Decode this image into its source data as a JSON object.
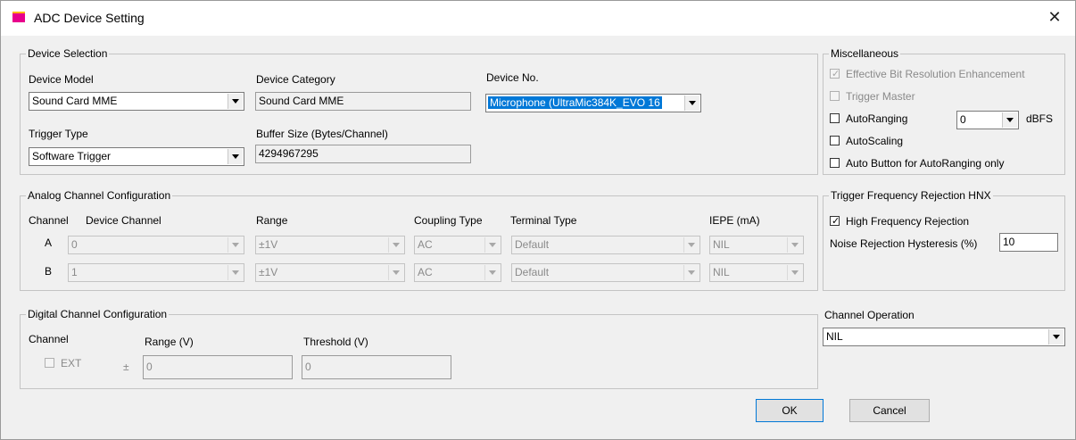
{
  "window": {
    "title": "ADC Device Setting",
    "close_glyph": "✕"
  },
  "device_selection": {
    "legend": "Device Selection",
    "model_label": "Device Model",
    "model_value": "Sound Card MME",
    "category_label": "Device Category",
    "category_value": "Sound Card MME",
    "device_no_label": "Device No.",
    "device_no_value": "Microphone (UltraMic384K_EVO 16",
    "trigger_label": "Trigger Type",
    "trigger_value": "Software Trigger",
    "buffer_label": "Buffer Size (Bytes/Channel)",
    "buffer_value": "4294967295"
  },
  "misc": {
    "legend": "Miscellaneous",
    "ebre": "Effective Bit Resolution Enhancement",
    "trigger_master": "Trigger Master",
    "autoranging": "AutoRanging",
    "autoranging_value": "0",
    "dbfs": "dBFS",
    "autoscaling": "AutoScaling",
    "auto_button": "Auto Button for AutoRanging only"
  },
  "analog": {
    "legend": "Analog Channel Configuration",
    "headers": {
      "channel": "Channel",
      "device_channel": "Device Channel",
      "range": "Range",
      "coupling": "Coupling Type",
      "terminal": "Terminal Type",
      "iepe": "IEPE (mA)"
    },
    "rows": [
      {
        "name": "A",
        "device_channel": "0",
        "range": "±1V",
        "coupling": "AC",
        "terminal": "Default",
        "iepe": "NIL"
      },
      {
        "name": "B",
        "device_channel": "1",
        "range": "±1V",
        "coupling": "AC",
        "terminal": "Default",
        "iepe": "NIL"
      }
    ]
  },
  "trigger_freq": {
    "legend": "Trigger Frequency Rejection HNX",
    "hfr": "High Frequency Rejection",
    "hysteresis_label": "Noise Rejection Hysteresis (%)",
    "hysteresis_value": "10"
  },
  "digital": {
    "legend": "Digital Channel Configuration",
    "channel": "Channel",
    "range_label": "Range (V)",
    "threshold_label": "Threshold (V)",
    "ext": "EXT",
    "pm": "±",
    "range_value": "0",
    "threshold_value": "0"
  },
  "channel_operation": {
    "label": "Channel Operation",
    "value": "NIL"
  },
  "buttons": {
    "ok": "OK",
    "cancel": "Cancel"
  }
}
